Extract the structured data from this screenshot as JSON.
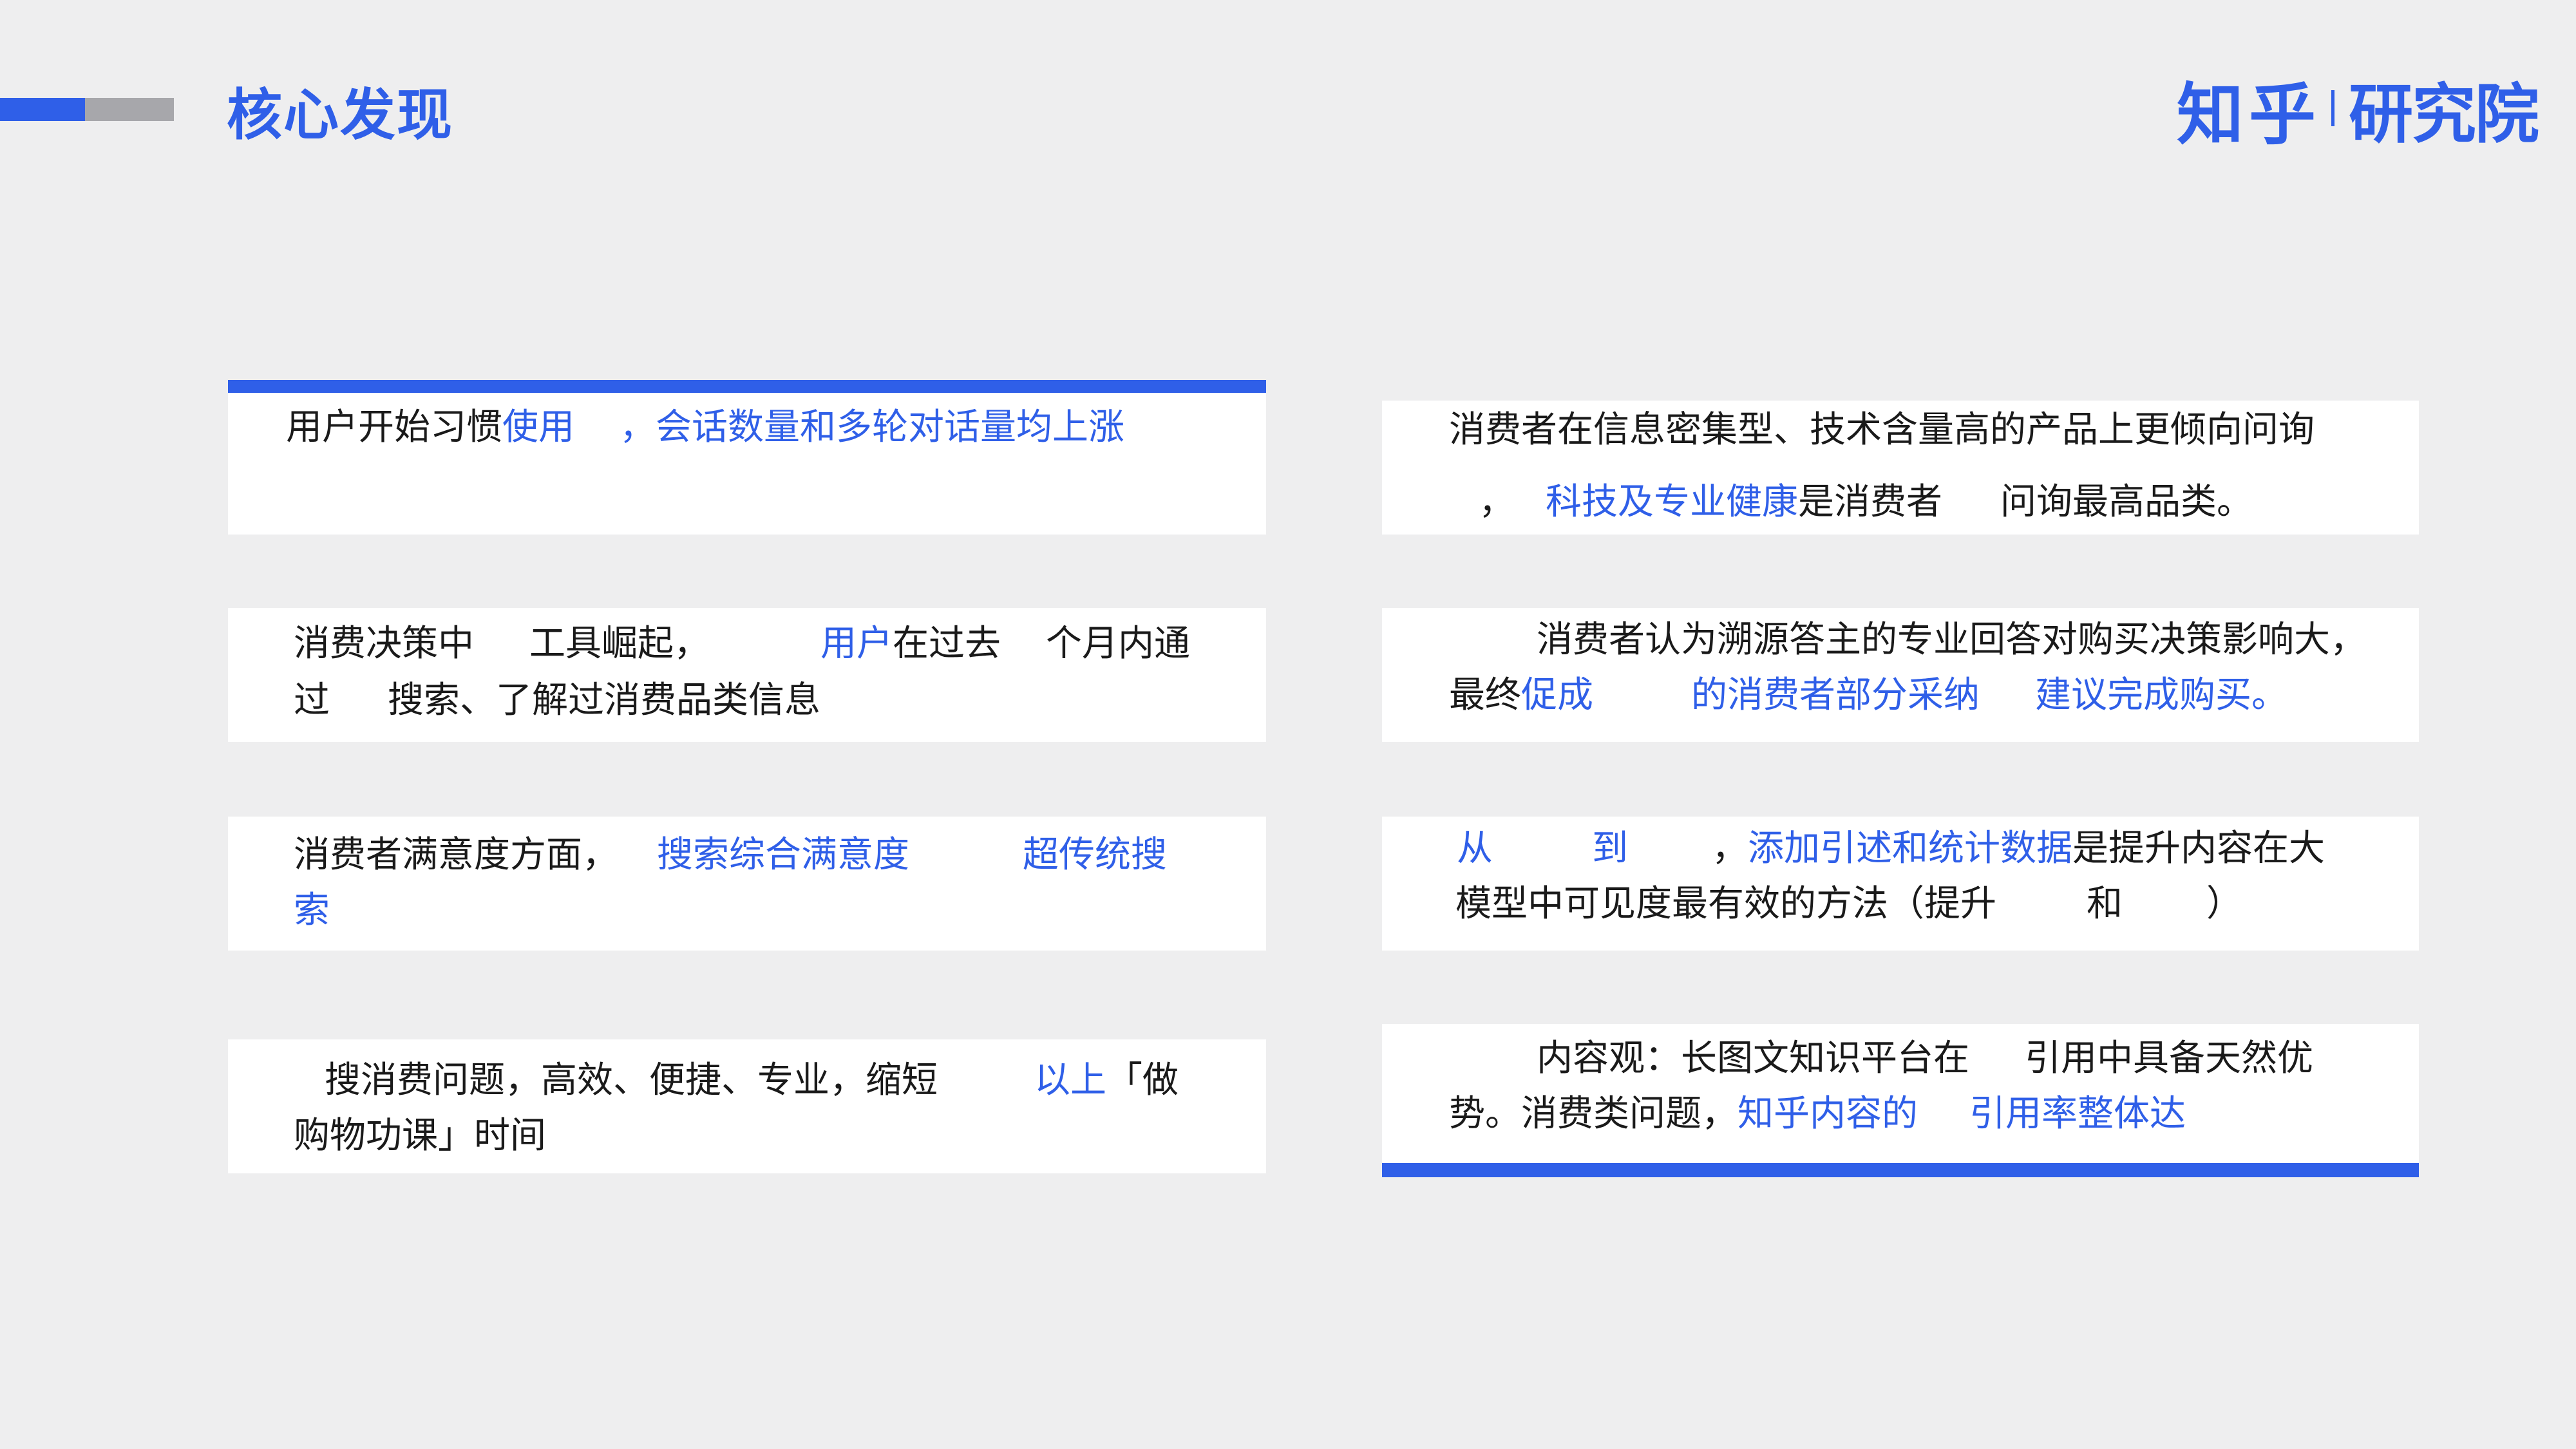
{
  "header": {
    "title": "核心发现",
    "logo_brand": "知乎",
    "logo_sub": "研究院"
  },
  "colors": {
    "accent": "#2f5fe8",
    "card_bg": "#ffffff",
    "page_bg": "#eeeeef",
    "gray_bar": "#a7a7ab"
  },
  "left_cards": [
    {
      "line1": {
        "a": "用户开始习惯",
        "b": "使用",
        "c": "，会话数量和多轮对话量均上涨"
      }
    },
    {
      "line1": {
        "a": "消费决策中",
        "b": "工具崛起，",
        "c": "用户",
        "d": "在过去",
        "e": "个月内通"
      },
      "line2": {
        "a": "过",
        "b": "搜索、了解过消费品类信息"
      }
    },
    {
      "line1": {
        "a": "消费者满意度方面，",
        "b": "搜索综合满意度",
        "c": "超传统搜"
      },
      "line2": {
        "a": "索"
      }
    },
    {
      "line1": {
        "a": "搜消费问题，高效、便捷、专业，缩短",
        "b": "以上",
        "c": "「做"
      },
      "line2": {
        "a": "购物功课」时间"
      }
    }
  ],
  "right_cards": [
    {
      "line1": {
        "a": "消费者在信息密集型、技术含量高的产品上更倾向问询"
      },
      "line2": {
        "a": "，",
        "b": "科技及专业健康",
        "c": "是消费者",
        "d": "问询最高品类。"
      }
    },
    {
      "line1": {
        "a": "消费者认为溯源答主的专业回答对购买决策影响大，"
      },
      "line2": {
        "a": "最终",
        "b": "促成",
        "c": "的消费者部分采纳",
        "d": "建议完成购买。"
      }
    },
    {
      "line1": {
        "a": "从",
        "b": "到",
        "c": "，",
        "d": "添加引述和统计数据",
        "e": "是提升内容在大"
      },
      "line2": {
        "a": "模型中可见度最有效的方法（提升",
        "b": "和",
        "c": "）"
      }
    },
    {
      "line1": {
        "a": "内容观：长图文知识平台在",
        "b": "引用中具备天然优"
      },
      "line2": {
        "a": "势。消费类问题，",
        "b": "知乎内容的",
        "c": "引用率整体达"
      }
    }
  ]
}
